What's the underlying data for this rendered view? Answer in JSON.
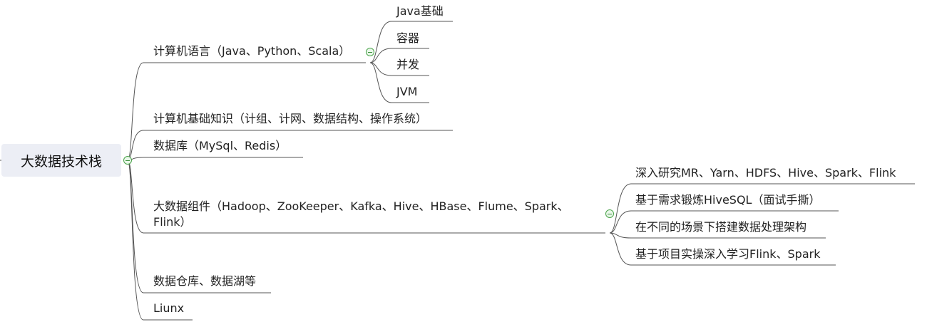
{
  "root": {
    "label": "大数据技术栈"
  },
  "branches": [
    {
      "label": "计算机语言（Java、Python、Scala）",
      "children": [
        "Java基础",
        "容器",
        "并发",
        "JVM"
      ]
    },
    {
      "label": "计算机基础知识（计组、计网、数据结构、操作系统）"
    },
    {
      "label": "数据库（MySql、Redis）"
    },
    {
      "label": "大数据组件（Hadoop、ZooKeeper、Kafka、Hive、HBase、Flume、Spark、Flink）",
      "children": [
        "深入研究MR、Yarn、HDFS、Hive、Spark、Flink",
        "基于需求锻炼HiveSQL（面试手撕）",
        "在不同的场景下搭建数据处理架构",
        "基于项目实操深入学习Flink、Spark"
      ]
    },
    {
      "label": "数据仓库、数据湖等"
    },
    {
      "label": "Liunx"
    }
  ],
  "colors": {
    "line": "#555555",
    "root_bg": "#eceef5",
    "toggle": "#4aa34a"
  }
}
